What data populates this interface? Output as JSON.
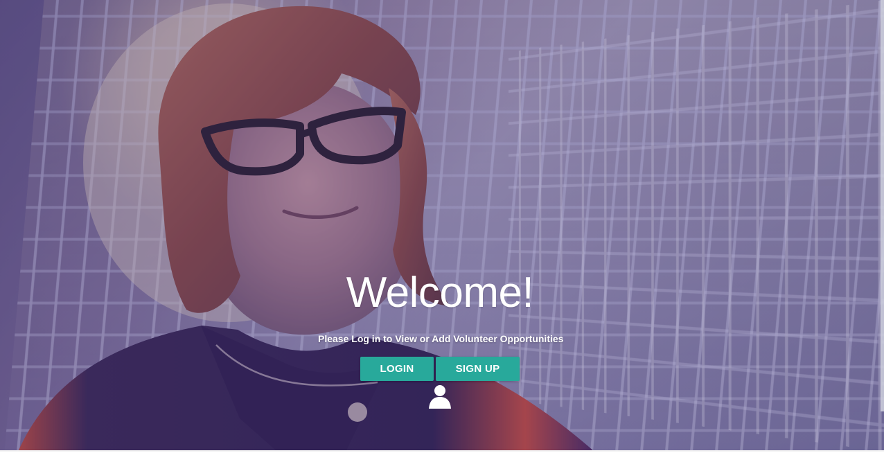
{
  "hero": {
    "heading": "Welcome!",
    "subtitle": "Please Log in to View or Add Volunteer Opportunities"
  },
  "actions": {
    "login_label": "LOGIN",
    "signup_label": "SIGN UP"
  },
  "icons": {
    "user": "user-icon"
  },
  "colors": {
    "button": "#28A99B",
    "overlay": "#42346E",
    "text": "#FFFFFF"
  }
}
